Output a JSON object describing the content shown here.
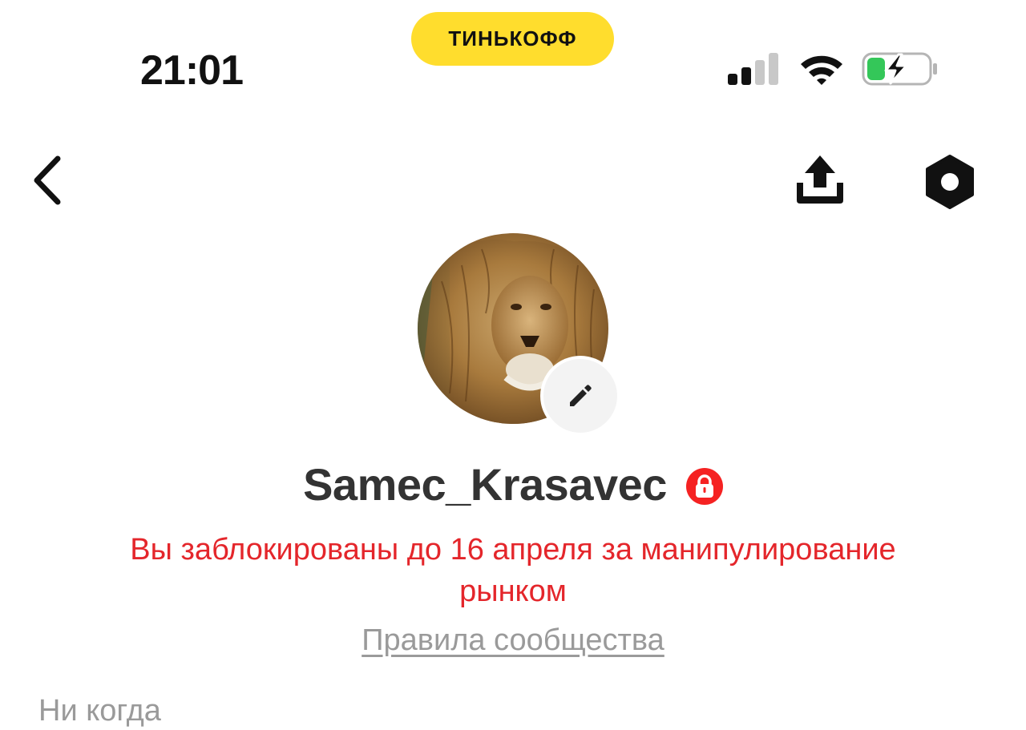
{
  "status_bar": {
    "time": "21:01",
    "carrier_badge": "ТИНЬКОФФ",
    "carrier_badge_color": "#ffdd2d",
    "signal_icon": "signal-icon",
    "wifi_icon": "wifi-icon",
    "battery_icon": "battery-charging-icon",
    "battery_level_fraction": 0.3
  },
  "nav": {
    "back_icon": "chevron-left-icon",
    "share_icon": "share-upload-icon",
    "settings_icon": "hexagon-settings-icon"
  },
  "profile": {
    "avatar_icon": "lion-avatar",
    "edit_icon": "pencil-icon",
    "username": "Samec_Krasavec",
    "lock_icon": "lock-icon",
    "block_message": "Вы заблокированы до 16 апреля за манипулирование рынком",
    "rules_link": "Правила сообщества",
    "last_seen": "Ни когда"
  },
  "colors": {
    "accent_red": "#e4262b",
    "badge_red": "#f52222",
    "muted_text": "#9a9a9a"
  }
}
